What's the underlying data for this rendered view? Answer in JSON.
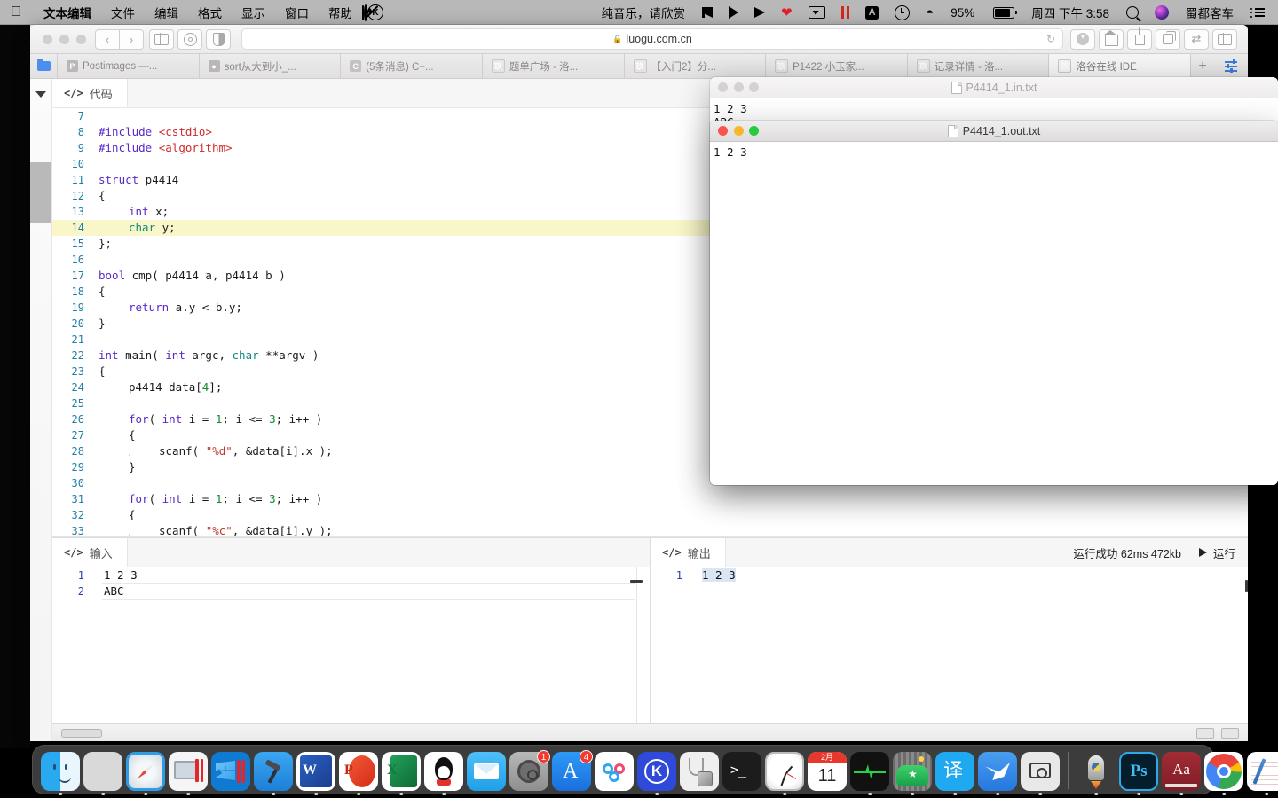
{
  "menubar": {
    "apple": "apple-logo",
    "items": [
      "文本编辑",
      "文件",
      "编辑",
      "格式",
      "显示",
      "窗口",
      "帮助"
    ],
    "now_playing": "纯音乐，请欣赏",
    "battery": "95%",
    "datetime": "周四 下午 3:58",
    "user": "蜀都客车"
  },
  "browser": {
    "url": "luogu.com.cn",
    "lock": "🔒",
    "tabs": [
      {
        "label": "Postimages —...",
        "favicon": "P",
        "active": false
      },
      {
        "label": "sort从大到小_...",
        "favicon": "B",
        "active": false
      },
      {
        "label": "(5条消息) C+...",
        "favicon": "C",
        "active": false
      },
      {
        "label": "题单广场 - 洛...",
        "favicon": "L",
        "active": false
      },
      {
        "label": "【入门2】分...",
        "favicon": "L",
        "active": false
      },
      {
        "label": "P1422 小玉家...",
        "favicon": "L",
        "active": false
      },
      {
        "label": "记录详情 - 洛...",
        "favicon": "L",
        "active": false
      },
      {
        "label": "洛谷在线 IDE",
        "favicon": "L",
        "active": true
      }
    ],
    "new_tab": "+"
  },
  "ide": {
    "code_tab": "代码",
    "input_tab": "输入",
    "output_tab": "输出",
    "run_status": "运行成功 62ms 472kb",
    "run_button": "运行",
    "code_lines": [
      {
        "n": "7",
        "html": ""
      },
      {
        "n": "8",
        "html": "<span class='inc'>#include</span> <span class='hdr'>&lt;cstdio&gt;</span>"
      },
      {
        "n": "9",
        "html": "<span class='inc'>#include</span> <span class='hdr'>&lt;algorithm&gt;</span>"
      },
      {
        "n": "10",
        "html": ""
      },
      {
        "n": "11",
        "html": "<span class='kw'>struct</span> p4414"
      },
      {
        "n": "12",
        "html": "{"
      },
      {
        "n": "13",
        "html": "<span class='ind'></span><span class='kw'>int</span> x;"
      },
      {
        "n": "14",
        "html": "<span class='ind'></span><span class='kw2'>char</span> y;",
        "hl": true
      },
      {
        "n": "15",
        "html": "};"
      },
      {
        "n": "16",
        "html": ""
      },
      {
        "n": "17",
        "html": "<span class='kw'>bool</span> cmp( p4414 a, p4414 b )"
      },
      {
        "n": "18",
        "html": "{"
      },
      {
        "n": "19",
        "html": "<span class='ind'></span><span class='kw'>return</span> a.y &lt; b.y;"
      },
      {
        "n": "20",
        "html": "}"
      },
      {
        "n": "21",
        "html": ""
      },
      {
        "n": "22",
        "html": "<span class='kw'>int</span> main( <span class='kw'>int</span> argc, <span class='kw2'>char</span> **argv )"
      },
      {
        "n": "23",
        "html": "{"
      },
      {
        "n": "24",
        "html": "<span class='ind'></span>p4414 data[<span class='num'>4</span>];"
      },
      {
        "n": "25",
        "html": "<span class='ind'></span>"
      },
      {
        "n": "26",
        "html": "<span class='ind'></span><span class='kw'>for</span>( <span class='kw'>int</span> i = <span class='num'>1</span>; i &lt;= <span class='num'>3</span>; i++ )"
      },
      {
        "n": "27",
        "html": "<span class='ind'></span>{"
      },
      {
        "n": "28",
        "html": "<span class='ind'></span><span class='ind'></span>scanf( <span class='str'>\"%d\"</span>, &amp;data[i].x );"
      },
      {
        "n": "29",
        "html": "<span class='ind'></span>}"
      },
      {
        "n": "30",
        "html": "<span class='ind'></span>"
      },
      {
        "n": "31",
        "html": "<span class='ind'></span><span class='kw'>for</span>( <span class='kw'>int</span> i = <span class='num'>1</span>; i &lt;= <span class='num'>3</span>; i++ )"
      },
      {
        "n": "32",
        "html": "<span class='ind'></span>{"
      },
      {
        "n": "33",
        "html": "<span class='ind'></span><span class='ind'></span>scanf( <span class='str'>\"%c\"</span>, &amp;data[i].y );"
      }
    ],
    "input_lines": [
      {
        "n": "1",
        "text": "1 2 3"
      },
      {
        "n": "2",
        "text": "ABC"
      }
    ],
    "output_lines": [
      {
        "n": "1",
        "text": "1 2 3",
        "selected": true
      }
    ]
  },
  "textedit_windows": [
    {
      "title": "P4414_1.in.txt",
      "active": false,
      "lines": [
        "1 2 3",
        "ABC"
      ]
    },
    {
      "title": "P4414_1.out.txt",
      "active": true,
      "lines": [
        "1 2 3"
      ]
    }
  ],
  "dock": {
    "items": [
      {
        "name": "finder",
        "badge": null,
        "running": true
      },
      {
        "name": "launchpad",
        "badge": null,
        "running": true
      },
      {
        "name": "safari",
        "badge": null,
        "running": true
      },
      {
        "name": "parallels",
        "badge": null,
        "running": true
      },
      {
        "name": "windows-vm",
        "badge": null,
        "running": false
      },
      {
        "name": "xcode",
        "badge": null,
        "running": true
      },
      {
        "name": "microsoft-word",
        "badge": null,
        "running": true
      },
      {
        "name": "powerpoint",
        "badge": null,
        "running": true
      },
      {
        "name": "excel",
        "badge": null,
        "running": true
      },
      {
        "name": "qq",
        "badge": null,
        "running": true
      },
      {
        "name": "mail",
        "badge": null,
        "running": false
      },
      {
        "name": "cleaner",
        "badge": "1",
        "running": false
      },
      {
        "name": "app-store",
        "badge": "4",
        "running": false
      },
      {
        "name": "baidu-netdisk",
        "badge": null,
        "running": false
      },
      {
        "name": "kugou",
        "badge": null,
        "running": true
      },
      {
        "name": "system-monitor",
        "badge": null,
        "running": false
      },
      {
        "name": "terminal",
        "badge": null,
        "running": false
      },
      {
        "name": "clock",
        "badge": null,
        "running": true
      },
      {
        "name": "calendar",
        "badge": null,
        "running": false,
        "month": "2月",
        "day": "11"
      },
      {
        "name": "activity-monitor",
        "badge": null,
        "running": true
      },
      {
        "name": "photos",
        "badge": null,
        "running": true
      },
      {
        "name": "translate",
        "badge": null,
        "running": true
      },
      {
        "name": "thunder",
        "badge": null,
        "running": true
      },
      {
        "name": "screenshot",
        "badge": null,
        "running": true
      },
      {
        "name": "pycharm",
        "badge": null,
        "running": true
      },
      {
        "name": "photoshop",
        "badge": null,
        "running": true
      },
      {
        "name": "dictionary",
        "badge": null,
        "running": true
      },
      {
        "name": "chrome",
        "badge": null,
        "running": true
      },
      {
        "name": "notes",
        "badge": null,
        "running": true
      },
      {
        "name": "text-file",
        "badge": null,
        "running": false
      },
      {
        "name": "trash",
        "badge": null,
        "running": false
      }
    ]
  },
  "colors": {
    "accent": "#3a7fd5",
    "highlight": "#f9f7c9",
    "keyword": "#5b28c8",
    "string": "#c0392b",
    "number": "#0f8a2e",
    "header": "#d02b2b"
  }
}
